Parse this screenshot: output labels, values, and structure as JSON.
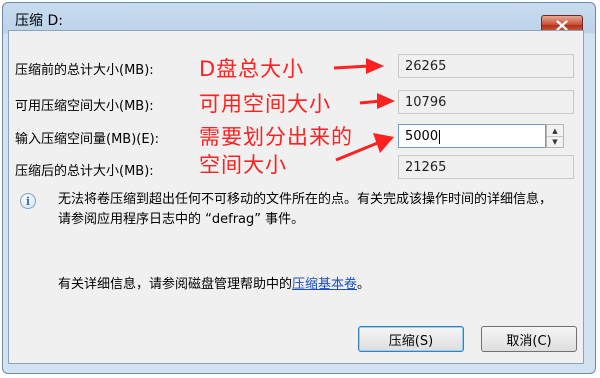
{
  "window": {
    "title": "压缩 D:",
    "close_icon": "close-icon"
  },
  "fields": [
    {
      "label": "压缩前的总计大小(MB):",
      "value": "26265"
    },
    {
      "label": "可用压缩空间大小(MB):",
      "value": "10796"
    },
    {
      "label": "输入压缩空间量(MB)(E):",
      "value": "5000"
    },
    {
      "label": "压缩后的总计大小(MB):",
      "value": "21265"
    }
  ],
  "annotations": {
    "a1": "D盘总大小",
    "a2": "可用空间大小",
    "a3_line1": "需要划分出来的",
    "a3_line2": "空间大小",
    "color": "#ff2020"
  },
  "info": {
    "text": "无法将卷压缩到超出任何不可移动的文件所在的点。有关完成该操作时间的详细信息，请参阅应用程序日志中的 “defrag” 事件。"
  },
  "help": {
    "prefix": "有关详细信息，请参阅磁盘管理帮助中的",
    "link": "压缩基本卷",
    "suffix": "。"
  },
  "buttons": {
    "shrink": "压缩(S)",
    "cancel": "取消(C)"
  }
}
